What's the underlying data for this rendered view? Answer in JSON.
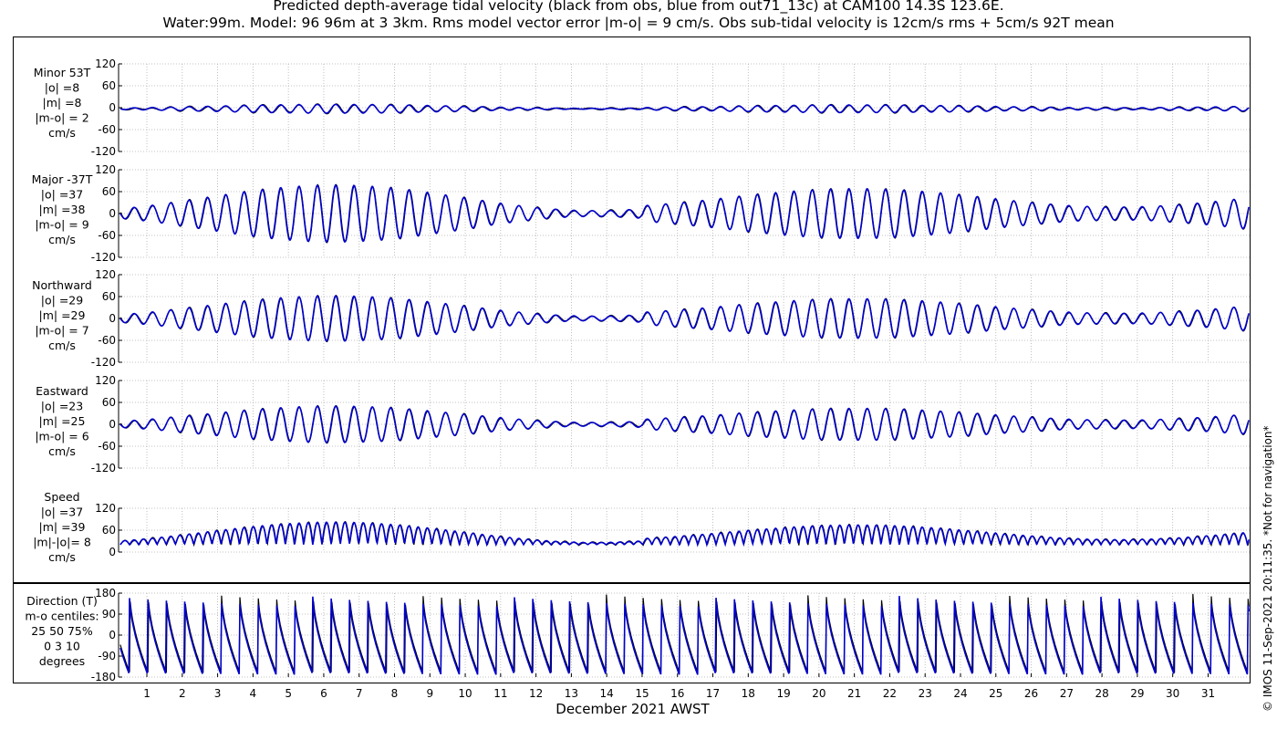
{
  "figure": {
    "title_line1": "Predicted depth-average tidal velocity (black from obs, blue from out71_13c) at CAM100 14.3S 123.6E.",
    "title_line2": "Water:99m. Model: 96 96m at 3 3km. Rms model vector error |m-o| = 9 cm/s. Obs sub-tidal velocity is 12cm/s rms + 5cm/s 92T mean",
    "xlabel": "December 2021 AWST",
    "credit": "© IMOS 11-Sep-2021 20:11:35. *Not for navigation*"
  },
  "colors": {
    "obs": "#000000",
    "model": "#0000cc",
    "grid": "#b0b0b0"
  },
  "chart_data": {
    "type": "line",
    "x_axis": {
      "label": "December 2021 AWST",
      "unit": "day",
      "range": [
        0.2,
        32.2
      ],
      "ticks": [
        1,
        2,
        3,
        4,
        5,
        6,
        7,
        8,
        9,
        10,
        11,
        12,
        13,
        14,
        15,
        16,
        17,
        18,
        19,
        20,
        21,
        22,
        23,
        24,
        25,
        26,
        27,
        28,
        29,
        30,
        31
      ],
      "grid": true
    },
    "series_note_colors": {
      "obs": "black",
      "model": "blue"
    },
    "panels": [
      {
        "id": "minor",
        "label_lines": [
          "Minor 53T",
          "|o| =8",
          "|m| =8",
          "|m-o| = 2",
          "cm/s"
        ],
        "ylim": [
          -120,
          120
        ],
        "yticks": [
          120,
          60,
          0,
          -60,
          -120
        ],
        "kind": "component",
        "amplitude_cm_s": 12,
        "mean_cm_s": -3,
        "approx_envelope": "spring-neap, peaks ~12 cm/s"
      },
      {
        "id": "major",
        "label_lines": [
          "Major -37T",
          "|o| =37",
          "|m| =38",
          "|m-o| = 9",
          "cm/s"
        ],
        "ylim": [
          -120,
          120
        ],
        "yticks": [
          120,
          60,
          0,
          -60,
          -120
        ],
        "kind": "component",
        "amplitude_cm_s": 78,
        "mean_cm_s": 0,
        "spring_days": [
          6.3,
          21.5
        ],
        "neap_days": [
          13.5,
          28.5
        ]
      },
      {
        "id": "northward",
        "label_lines": [
          "Northward",
          "|o| =29",
          "|m| =29",
          "|m-o| = 7",
          "cm/s"
        ],
        "ylim": [
          -120,
          120
        ],
        "yticks": [
          120,
          60,
          0,
          -60,
          -120
        ],
        "kind": "component",
        "amplitude_cm_s": 62,
        "mean_cm_s": 0
      },
      {
        "id": "eastward",
        "label_lines": [
          "Eastward",
          "|o| =23",
          "|m| =25",
          "|m-o| = 6",
          "cm/s"
        ],
        "ylim": [
          -120,
          120
        ],
        "yticks": [
          120,
          60,
          0,
          -60,
          -120
        ],
        "kind": "component",
        "amplitude_cm_s": 50,
        "mean_cm_s": 0
      },
      {
        "id": "speed",
        "label_lines": [
          "Speed",
          "|o| =37",
          "|m| =39",
          "|m|-|o|= 8",
          "cm/s"
        ],
        "ylim": [
          0,
          120
        ],
        "yticks": [
          120,
          60,
          0
        ],
        "kind": "speed",
        "amplitude_cm_s": 82,
        "mean_cm_s": 0
      },
      {
        "id": "direction",
        "label_lines": [
          "Direction (T)",
          "m-o centiles:",
          "25  50  75%",
          "0   3  10",
          "degrees"
        ],
        "ylim": [
          -180,
          180
        ],
        "yticks": [
          180,
          90,
          0,
          -90,
          -180
        ],
        "kind": "direction",
        "tick_label_unit": "degrees True"
      }
    ]
  }
}
